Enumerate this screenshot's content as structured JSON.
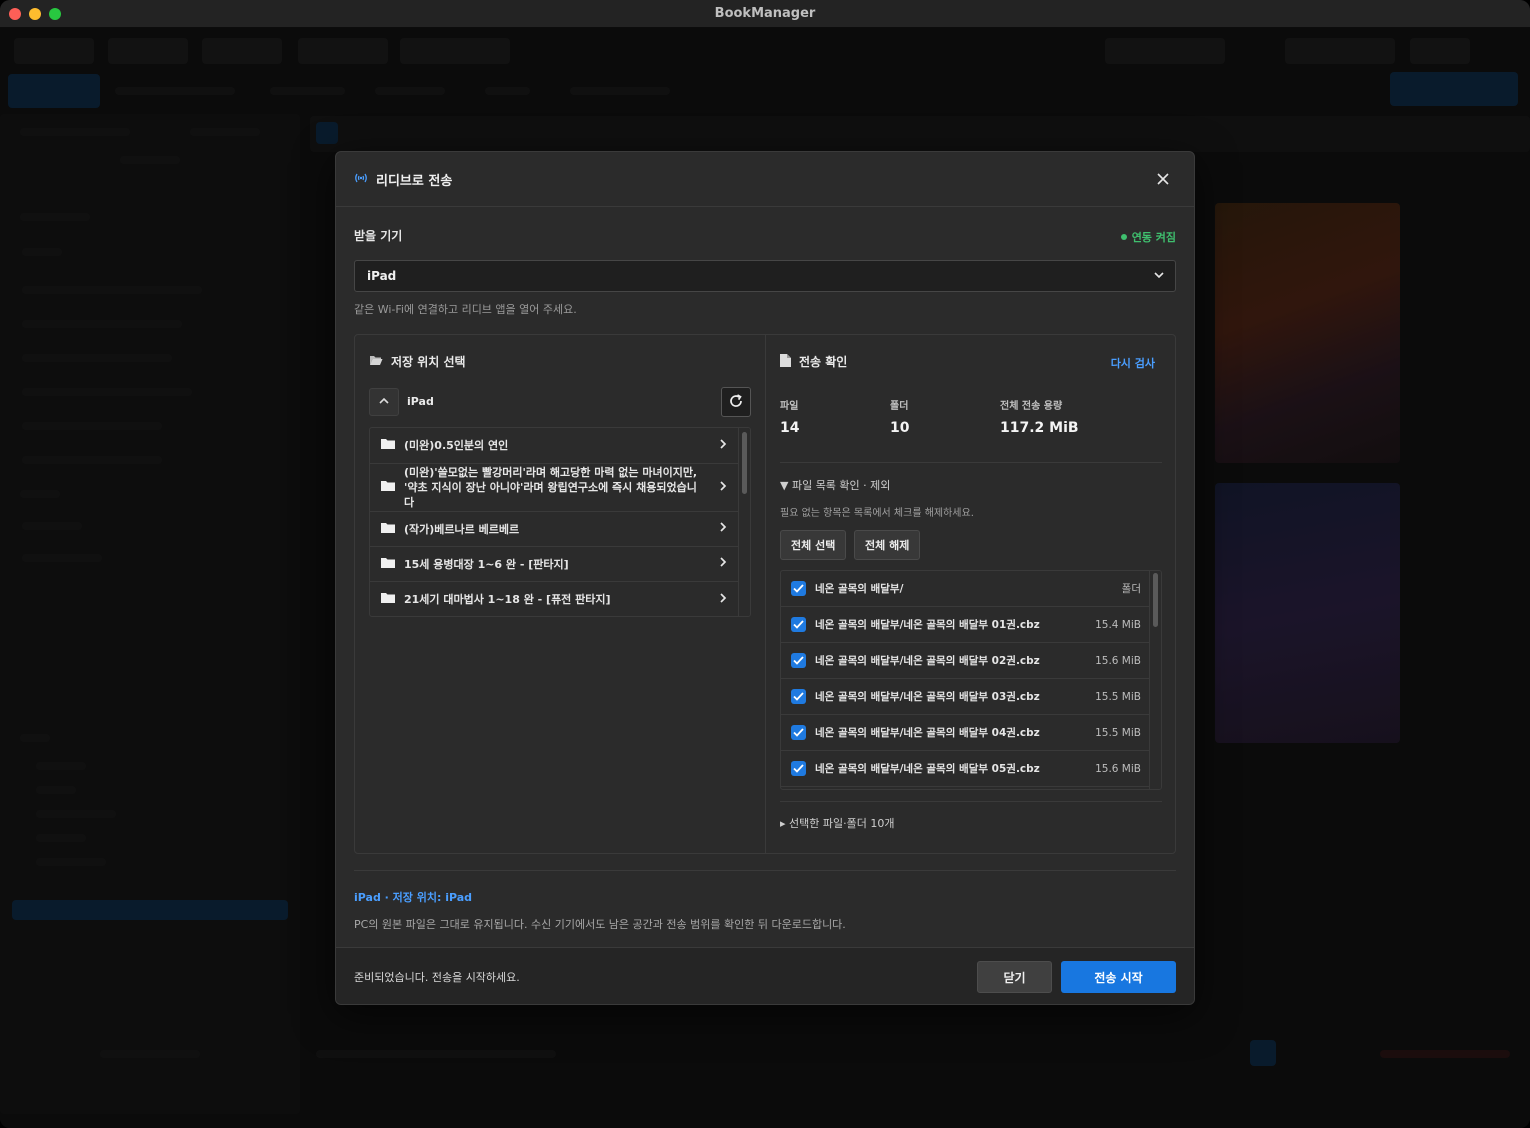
{
  "window": {
    "title": "BookManager"
  },
  "modal": {
    "title": "리디브로 전송",
    "receiving_device_label": "받을 기기",
    "connection_status": "연동 켜짐",
    "device_selected": "iPad",
    "device_hint": "같은 Wi-Fi에 연결하고 리디브 앱을 열어 주세요.",
    "left_panel": {
      "title": "저장 위치 선택",
      "current_path": "iPad",
      "folders": [
        {
          "name": "(미완)0.5인분의 연인"
        },
        {
          "name": "(미완)'쓸모없는 빨강머리'라며 해고당한 마력 없는 마녀이지만, '약초 지식이 장난 아니야'라며 왕립연구소에 즉시 채용되었습니다"
        },
        {
          "name": "(작가)베르나르 베르베르"
        },
        {
          "name": "15세 용병대장 1~6 완 - [판타지]"
        },
        {
          "name": "21세기 대마법사 1~18 완 - [퓨전 판타지]"
        }
      ]
    },
    "right_panel": {
      "title": "전송 확인",
      "recheck_label": "다시 검사",
      "stats": [
        {
          "label": "파일",
          "value": "14"
        },
        {
          "label": "폴더",
          "value": "10"
        },
        {
          "label": "전체 전송 용량",
          "value": "117.2 MiB"
        }
      ],
      "file_list_toggle": "▼ 파일 목록 확인 · 제외",
      "file_list_hint": "필요 없는 항목은 목록에서 체크를 해제하세요.",
      "select_all_label": "전체 선택",
      "deselect_all_label": "전체 해제",
      "files": [
        {
          "name": "네온 골목의 배달부/",
          "size": "폴더"
        },
        {
          "name": "네온 골목의 배달부/네온 골목의 배달부 01권.cbz",
          "size": "15.4 MiB"
        },
        {
          "name": "네온 골목의 배달부/네온 골목의 배달부 02권.cbz",
          "size": "15.6 MiB"
        },
        {
          "name": "네온 골목의 배달부/네온 골목의 배달부 03권.cbz",
          "size": "15.5 MiB"
        },
        {
          "name": "네온 골목의 배달부/네온 골목의 배달부 04권.cbz",
          "size": "15.5 MiB"
        },
        {
          "name": "네온 골목의 배달부/네온 골목의 배달부 05권.cbz",
          "size": "15.6 MiB"
        }
      ],
      "selected_toggle": "▸ 선택한 파일·폴더 10개"
    },
    "destination_info": "iPad · 저장 위치: iPad",
    "preserve_note": "PC의 원본 파일은 그대로 유지됩니다. 수신 기기에서도 남은 공간과 전송 범위를 확인한 뒤 다운로드합니다.",
    "footer_status": "준비되었습니다. 전송을 시작하세요.",
    "close_label": "닫기",
    "start_label": "전송 시작"
  },
  "colors": {
    "accent": "#1877e0",
    "link": "#4a9eff",
    "success": "#3fbf6e"
  },
  "icons": [
    "broadcast-icon",
    "close-icon",
    "chevron-down-icon",
    "folder-open-icon",
    "chevron-up-icon",
    "refresh-icon",
    "folder-icon",
    "chevron-right-icon",
    "file-icon",
    "checkbox-checked-icon"
  ]
}
